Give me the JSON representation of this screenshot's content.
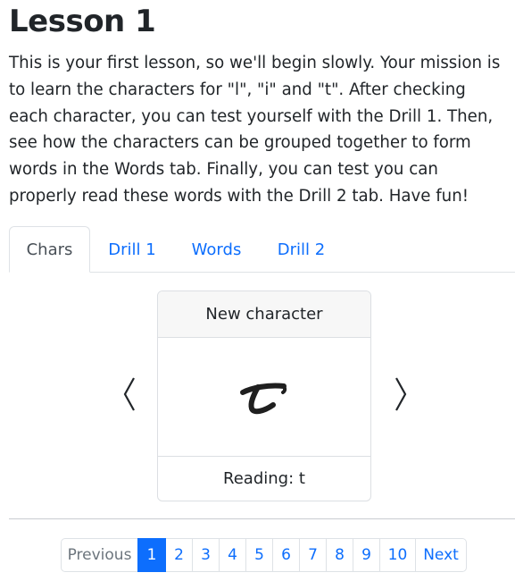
{
  "lesson": {
    "title": "Lesson 1",
    "intro": "This is your first lesson, so we'll begin slowly. Your mission is to learn the characters for \"l\", \"i\" and \"t\". After checking each character, you can test yourself with the Drill 1. Then, see how the characters can be grouped together to form words in the Words tab. Finally, you can test you can properly read these words with the Drill 2 tab. Have fun!"
  },
  "tabs": [
    {
      "label": "Chars",
      "active": true
    },
    {
      "label": "Drill 1",
      "active": false
    },
    {
      "label": "Words",
      "active": false
    },
    {
      "label": "Drill 2",
      "active": false
    }
  ],
  "carousel": {
    "prev_icon": "chevron-left-icon",
    "next_icon": "chevron-right-icon",
    "card": {
      "header": "New character",
      "glyph_icon": "handwritten-t-glyph",
      "reading": "Reading: t"
    }
  },
  "pagination": {
    "previous_label": "Previous",
    "next_label": "Next",
    "pages": [
      "1",
      "2",
      "3",
      "4",
      "5",
      "6",
      "7",
      "8",
      "9",
      "10"
    ],
    "active_page": "1"
  },
  "colors": {
    "accent": "#0d6efd",
    "text": "#212529",
    "muted": "#6c757d",
    "border": "#dee2e6"
  }
}
